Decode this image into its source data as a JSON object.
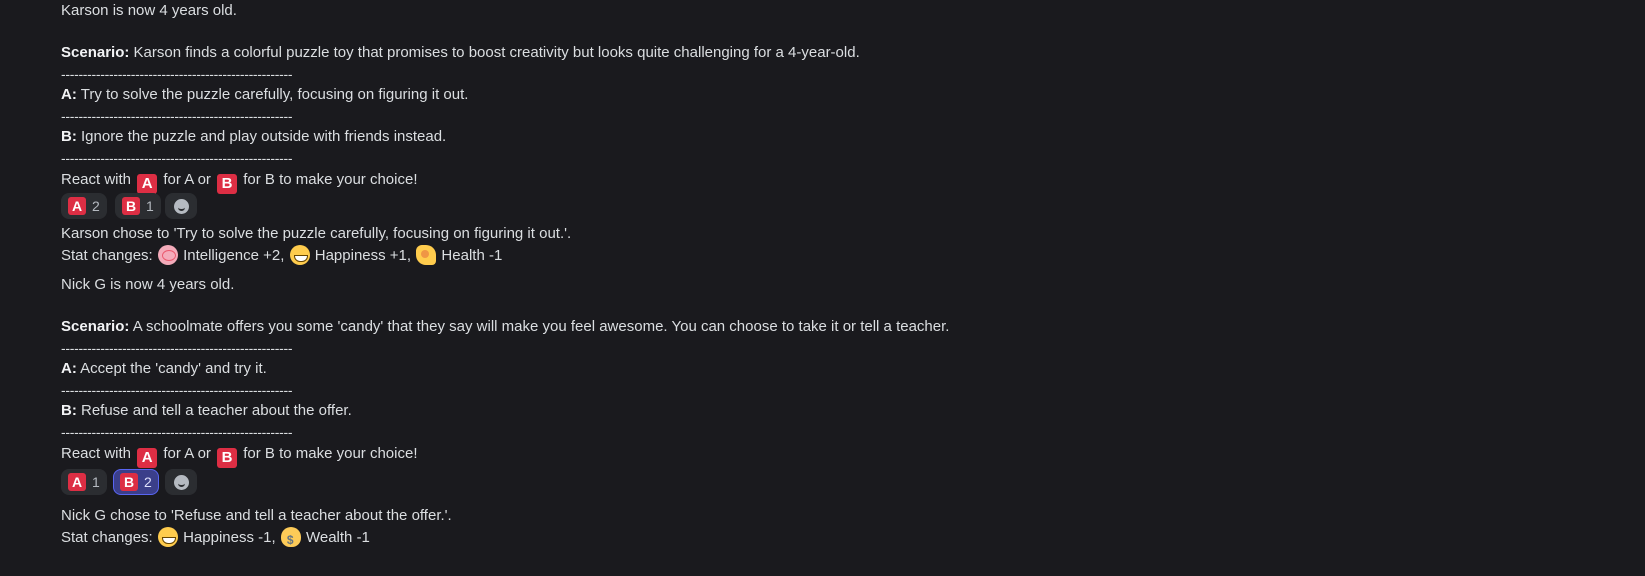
{
  "messages": [
    {
      "intro": "Karson is now 4 years old.",
      "scenario_label": "Scenario:",
      "scenario_text": " Karson finds a colorful puzzle toy that promises to boost creativity but looks quite challenging for a 4-year-old.",
      "divider": "-----------------------------------------------------",
      "option_a_label": "A:",
      "option_a_text": " Try to solve the puzzle carefully, focusing on figuring it out.",
      "option_b_label": "B:",
      "option_b_text": " Ignore the puzzle and play outside with friends instead.",
      "react_prefix": "React with",
      "react_a_letter": "A",
      "react_mid": "for A or",
      "react_b_letter": "B",
      "react_suffix": "for B to make your choice!",
      "reactions": [
        {
          "emoji": "A",
          "count": "2",
          "active": false
        },
        {
          "emoji": "B",
          "count": "1",
          "active": false
        }
      ],
      "result": "Karson chose to 'Try to solve the puzzle carefully, focusing on figuring it out.'.",
      "stat_prefix": "Stat changes:",
      "stats": [
        {
          "icon": "brain-icon",
          "text": "Intelligence +2,"
        },
        {
          "icon": "grinning-face-icon",
          "text": "Happiness +1,"
        },
        {
          "icon": "flexed-biceps-icon",
          "text": "Health -1"
        }
      ]
    },
    {
      "intro": "Nick G is now 4 years old.",
      "scenario_label": "Scenario:",
      "scenario_text": " A schoolmate offers you some 'candy' that they say will make you feel awesome. You can choose to take it or tell a teacher.",
      "divider": "-----------------------------------------------------",
      "option_a_label": "A:",
      "option_a_text": " Accept the 'candy' and try it.",
      "option_b_label": "B:",
      "option_b_text": " Refuse and tell a teacher about the offer.",
      "react_prefix": "React with",
      "react_a_letter": "A",
      "react_mid": "for A or",
      "react_b_letter": "B",
      "react_suffix": "for B to make your choice!",
      "reactions": [
        {
          "emoji": "A",
          "count": "1",
          "active": false
        },
        {
          "emoji": "B",
          "count": "2",
          "active": true
        }
      ],
      "result": "Nick G chose to 'Refuse and tell a teacher about the offer.'.",
      "stat_prefix": "Stat changes:",
      "stats": [
        {
          "icon": "grinning-face-icon",
          "text": "Happiness -1,"
        },
        {
          "icon": "money-bag-icon",
          "text": "Wealth -1"
        }
      ]
    }
  ],
  "colors": {
    "background": "#1a1a1e",
    "text": "#dbdee1",
    "letter_emoji": "#dd2e44",
    "active_reaction": "#3b3f8a",
    "active_border": "#5865f2"
  }
}
